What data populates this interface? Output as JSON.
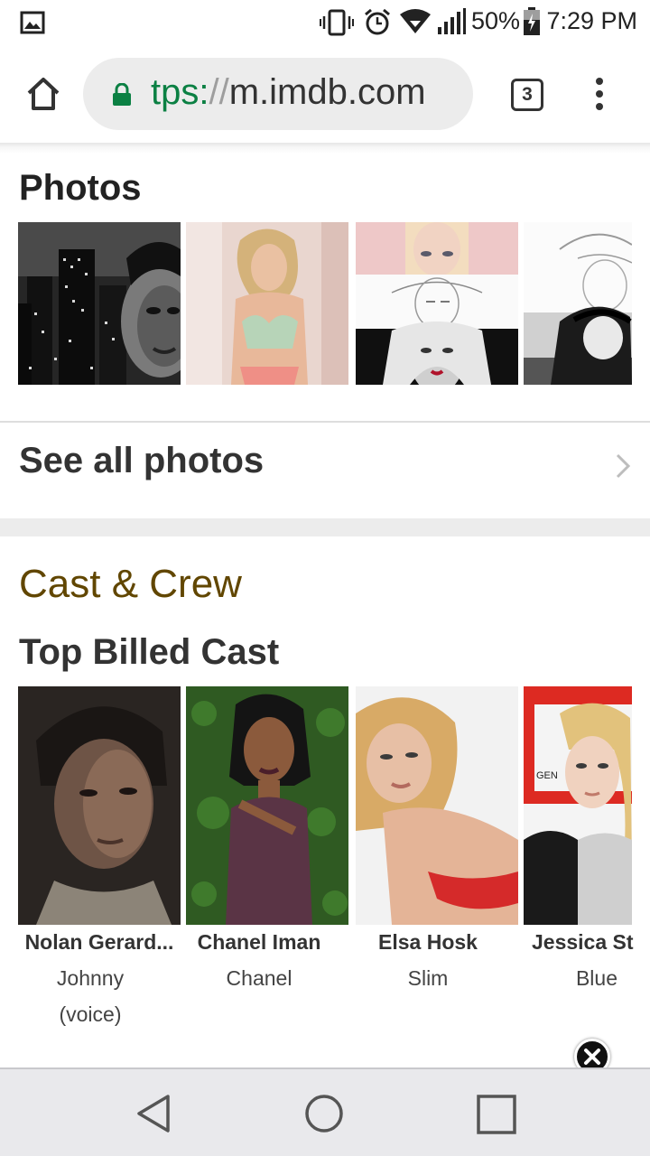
{
  "status_bar": {
    "battery_percent": "50%",
    "time": "7:29 PM",
    "icons": [
      "gallery-icon",
      "vibrate-icon",
      "alarm-icon",
      "wifi-icon",
      "signal-icon",
      "battery-charging-icon"
    ]
  },
  "browser": {
    "url_scheme": "tps:",
    "url_sep": "//",
    "url_host": "m.imdb.com",
    "tab_count": "3",
    "icons": [
      "home-icon",
      "lock-icon",
      "overflow-menu-icon"
    ]
  },
  "photos": {
    "heading": "Photos",
    "see_all": "See all photos"
  },
  "cast_crew": {
    "title": "Cast & Crew",
    "top_billed": "Top Billed Cast",
    "members": [
      {
        "name": "Nolan Gerard...",
        "role_line1": "Johnny",
        "role_line2": "(voice)"
      },
      {
        "name": "Chanel Iman",
        "role_line1": "Chanel",
        "role_line2": ""
      },
      {
        "name": "Elsa Hosk",
        "role_line1": "Slim",
        "role_line2": ""
      },
      {
        "name": "Jessica St",
        "role_line1": "Blue",
        "role_line2": ""
      }
    ]
  },
  "colors": {
    "cast_crew_title": "#614600",
    "url_scheme": "#0b8043",
    "lock": "#0b8043"
  }
}
